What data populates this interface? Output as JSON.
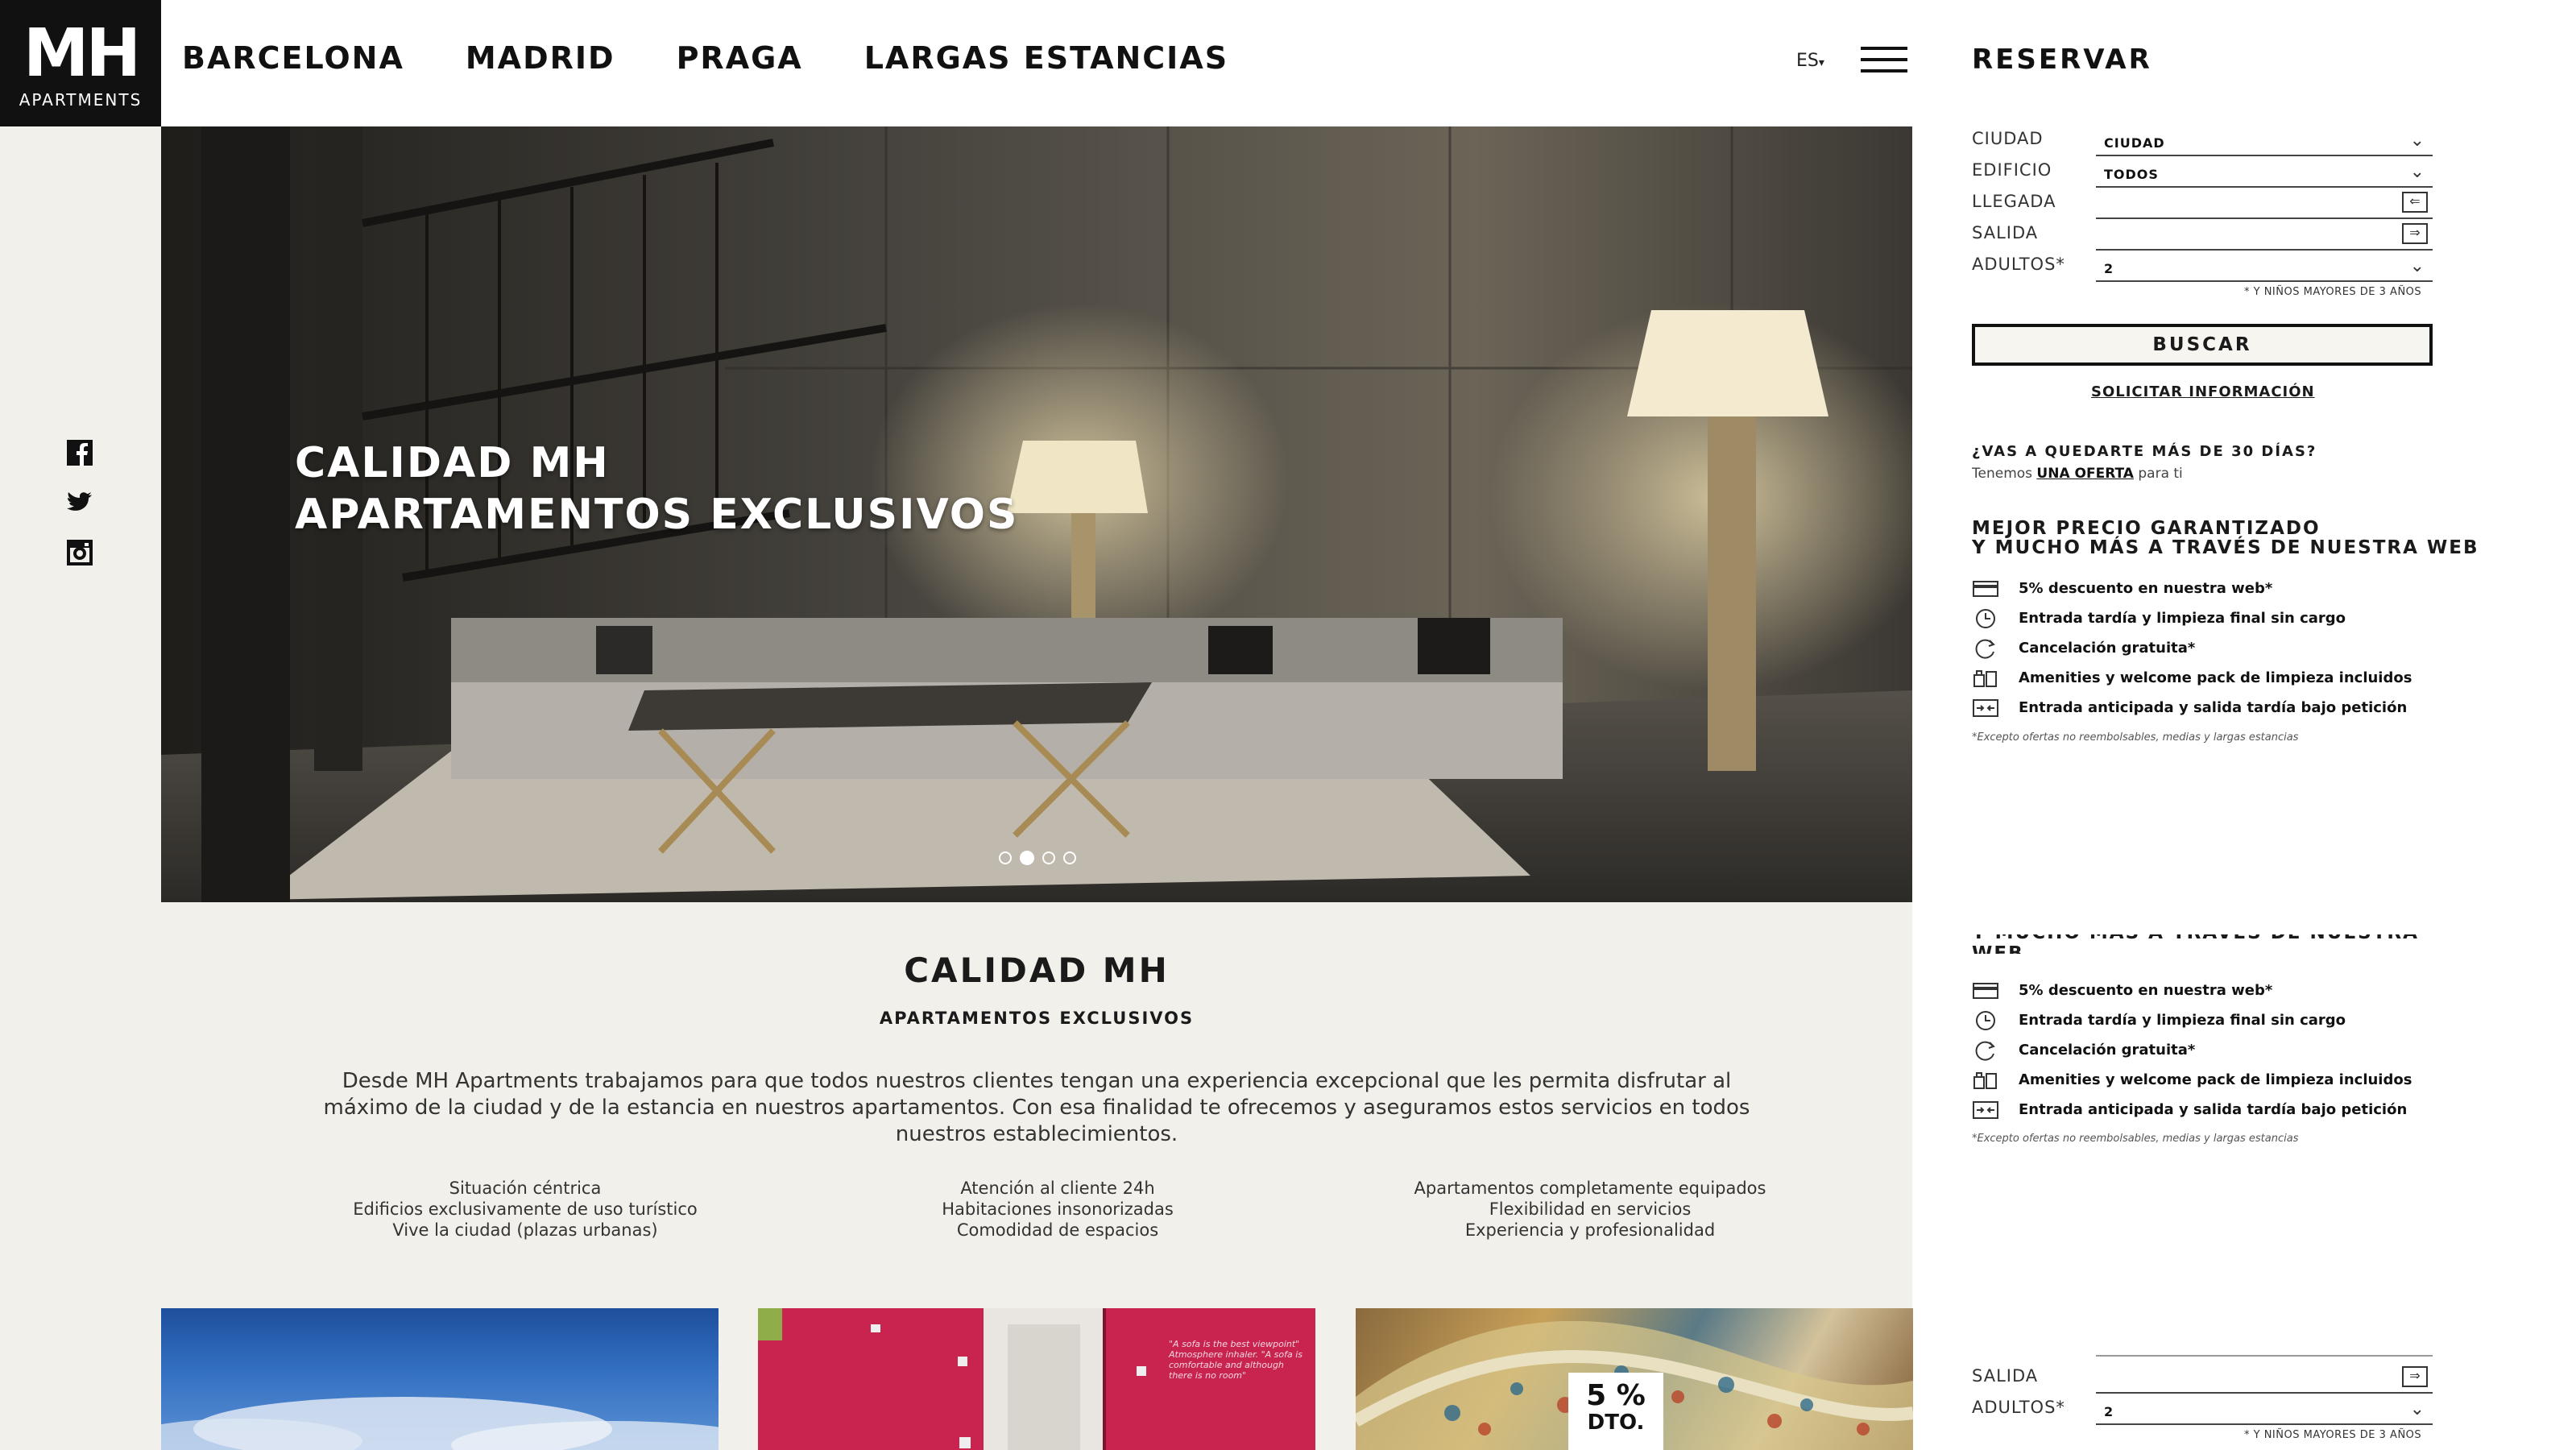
{
  "logo": {
    "big": "MH",
    "small": "APARTMENTS"
  },
  "nav": [
    "BARCELONA",
    "MADRID",
    "PRAGA",
    "LARGAS ESTANCIAS"
  ],
  "lang": "ES",
  "reservar_label": "RESERVAR",
  "form": {
    "ciudad": {
      "label": "CIUDAD",
      "value": "CIUDAD"
    },
    "edificio": {
      "label": "EDIFICIO",
      "value": "TODOS"
    },
    "llegada": {
      "label": "LLEGADA",
      "value": ""
    },
    "salida": {
      "label": "SALIDA",
      "value": ""
    },
    "adultos": {
      "label": "ADULTOS*",
      "value": "2"
    },
    "children_note": "* Y NIÑOS MAYORES DE 3 AÑOS",
    "search_label": "BUSCAR",
    "info_link": "SOLICITAR INFORMACIÓN"
  },
  "long_stay": {
    "question": "¿VAS A QUEDARTE MÁS DE 30 DÍAS?",
    "prefix": "Tenemos",
    "link": "UNA OFERTA",
    "suffix": "para ti"
  },
  "best_price": {
    "title_line1": "MEJOR PRECIO GARANTIZADO",
    "title_line2": "Y MUCHO MÁS A TRAVÉS DE NUESTRA WEB",
    "benefits": [
      {
        "icon": "credit-card-icon",
        "text": "5% descuento en nuestra web*"
      },
      {
        "icon": "late-checkin-icon",
        "text": "Entrada tardía y limpieza final sin cargo"
      },
      {
        "icon": "cancel-refresh-icon",
        "text": "Cancelación gratuita*"
      },
      {
        "icon": "amenities-icon",
        "text": "Amenities y welcome pack de limpieza incluidos"
      },
      {
        "icon": "calendar-arrows-icon",
        "text": "Entrada anticipada y salida tardía bajo petición"
      }
    ],
    "exception": "*Excepto ofertas no reembolsables, medias y largas estancias"
  },
  "hero": {
    "title_line1": "CALIDAD MH",
    "title_line2": "APARTAMENTOS EXCLUSIVOS",
    "slides_total": 4,
    "active_slide": 2
  },
  "section": {
    "title": "CALIDAD MH",
    "subtitle": "APARTAMENTOS EXCLUSIVOS",
    "description": "Desde MH Apartments trabajamos para que todos nuestros clientes tengan una experiencia excepcional que les permita disfrutar al máximo de la ciudad y de la estancia en nuestros apartamentos. Con esa finalidad te ofrecemos y aseguramos estos servicios en todos nuestros establecimientos.",
    "features": [
      [
        "Situación céntrica",
        "Edificios exclusivamente de uso turístico",
        "Vive la ciudad (plazas urbanas)"
      ],
      [
        "Atención al cliente 24h",
        "Habitaciones insonorizadas",
        "Comodidad de espacios"
      ],
      [
        "Apartamentos completamente equipados",
        "Flexibilidad en servicios",
        "Experiencia y profesionalidad"
      ]
    ]
  },
  "cards": {
    "card2_wall_text": "\"A sofa is the best viewpoint\" Atmosphere inhaler. \"A sofa is comfortable and although there is no room\"",
    "discount_big": "5 %",
    "discount_small": "DTO."
  },
  "colors": {
    "background": "#f2f0ea",
    "panel": "#ffffff",
    "logo_bg": "#111111",
    "accent_pink": "#c8244f"
  }
}
